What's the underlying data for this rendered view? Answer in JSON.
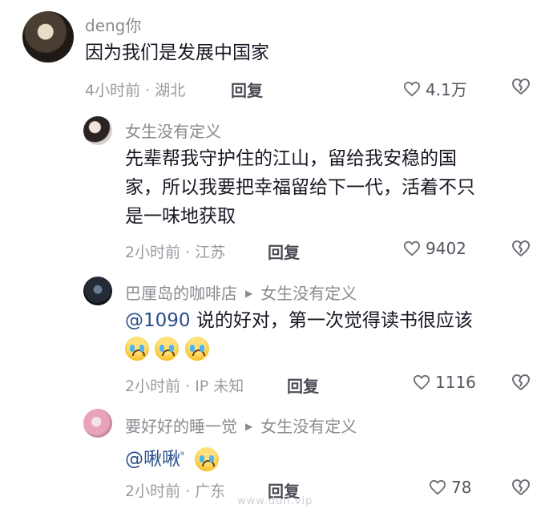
{
  "comments": [
    {
      "username": "deng你",
      "content": "因为我们是发展中国家",
      "meta": "4小时前 · 湖北",
      "reply_label": "回复",
      "likes": "4.1万"
    },
    {
      "username": "女生没有定义",
      "content_lines": [
        "先辈帮我守护住的江山，留给我安稳的国",
        "家，所以我要把幸福留给下一代，活着不只",
        "是一味地获取"
      ],
      "meta": "2小时前 · 江苏",
      "reply_label": "回复",
      "likes": "9402"
    },
    {
      "username": "巴厘岛的咖啡店",
      "reply_to": "女生没有定义",
      "mention": "@1090",
      "content": " 说的好对，第一次觉得读书很应该",
      "meta": "2小时前 · IP 未知",
      "reply_label": "回复",
      "likes": "1116"
    },
    {
      "username": "要好好的睡一觉",
      "reply_to": "女生没有定义",
      "mention": "@啾啾",
      "mention_sup": "⁹",
      "meta": "2小时前 · 广东",
      "reply_label": "回复",
      "likes": "78"
    }
  ],
  "watermark": "www.duil.vip",
  "icons": {
    "like": "heart-outline-icon",
    "dislike": "broken-heart-icon",
    "emoji": "crying-face-emoji"
  }
}
